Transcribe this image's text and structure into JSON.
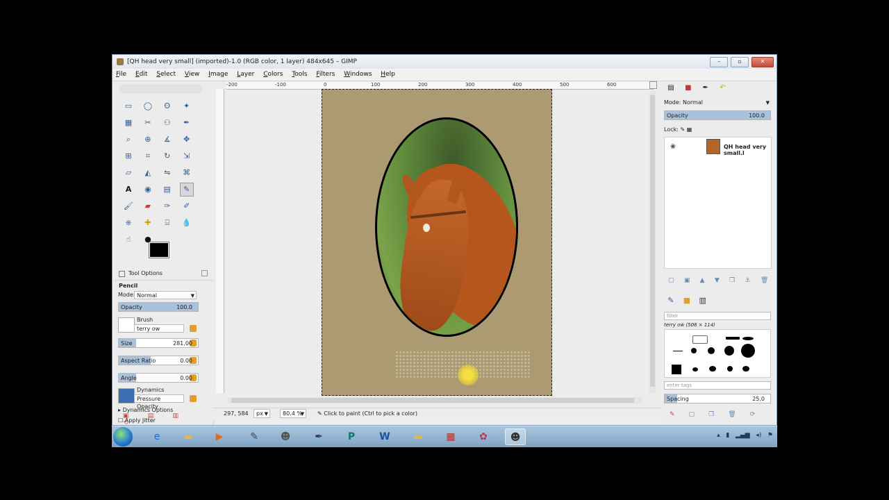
{
  "window": {
    "title": "[QH head very small] (imported)-1.0 (RGB color, 1 layer) 484x645 – GIMP",
    "controls": {
      "minimize": "–",
      "maximize": "▫",
      "close": "✕"
    }
  },
  "menu": [
    "File",
    "Edit",
    "Select",
    "View",
    "Image",
    "Layer",
    "Colors",
    "Tools",
    "Filters",
    "Windows",
    "Help"
  ],
  "tool_options": {
    "panel_title": "Tool Options",
    "tool_name": "Pencil",
    "mode_label": "Mode:",
    "mode_value": "Normal",
    "opacity_label": "Opacity",
    "opacity_value": "100.0",
    "brush_label": "Brush",
    "brush_name": "terry ow",
    "size_label": "Size",
    "size_value": "281.00",
    "aspect_label": "Aspect Ratio",
    "aspect_value": "0.00",
    "angle_label": "Angle",
    "angle_value": "0.00",
    "dynamics_label": "Dynamics",
    "dynamics_value": "Pressure Opacity",
    "dynamics_options": "Dynamics Options",
    "jitter_label": "Apply Jitter"
  },
  "ruler": {
    "h_ticks": [
      "-200",
      "-100",
      "0",
      "100",
      "200",
      "300",
      "400",
      "500",
      "600"
    ]
  },
  "status": {
    "coords": "297, 584",
    "unit": "px",
    "zoom": "80.4 %",
    "message": "Click to paint (Ctrl to pick a color)"
  },
  "layers": {
    "mode_label": "Mode:",
    "mode_value": "Normal",
    "opacity_label": "Opacity",
    "opacity_value": "100.0",
    "lock_label": "Lock:",
    "layer_name": "QH head very small.l"
  },
  "brushes": {
    "filter_placeholder": "filter",
    "current": "terry ow (508 × 114)",
    "tags_placeholder": "enter tags",
    "spacing_label": "Spacing",
    "spacing_value": "25.0"
  },
  "taskbar": {
    "items": [
      "ie-icon",
      "explorer-icon",
      "media-player-icon",
      "paint-icon",
      "gimp-wilber-icon",
      "pen-icon",
      "publisher-icon",
      "word-icon",
      "folder-icon",
      "archive-icon",
      "paint-brush-icon",
      "gimp-active-icon"
    ]
  }
}
